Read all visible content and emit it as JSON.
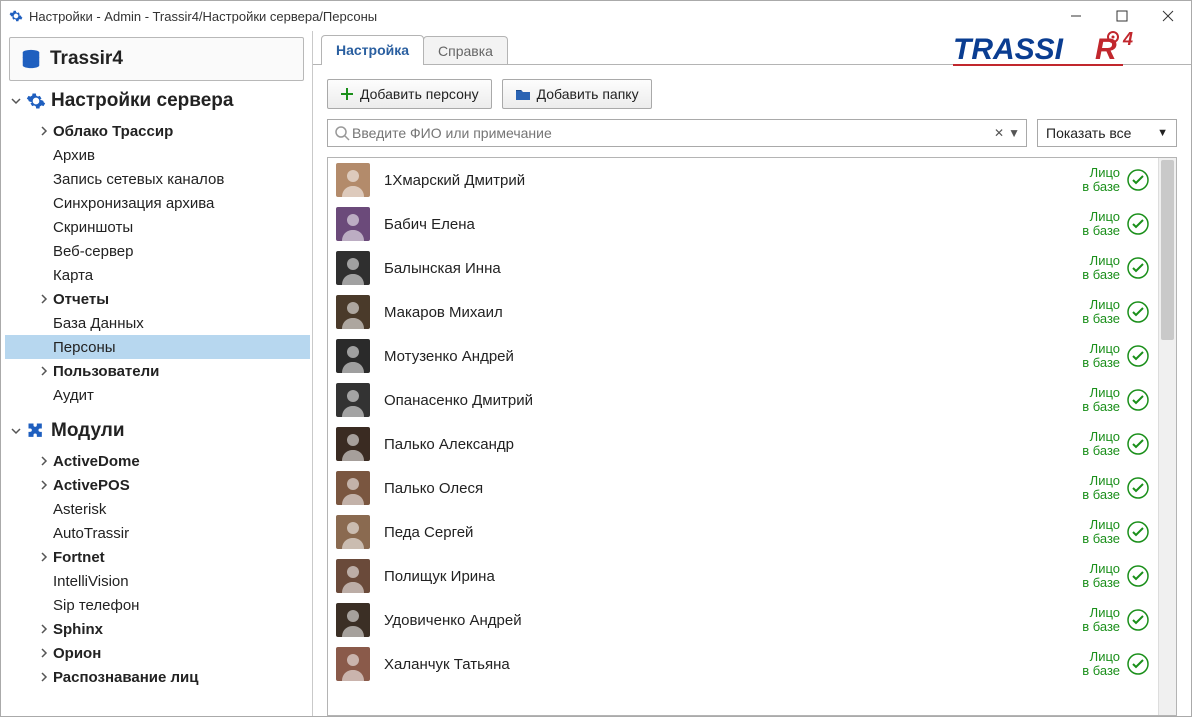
{
  "window": {
    "title": "Настройки - Admin - Trassir4/Настройки сервера/Персоны"
  },
  "logo": {
    "text": "TRASSIR",
    "sup": "4"
  },
  "server": {
    "name": "Trassir4"
  },
  "tree": {
    "serverSettings": "Настройки сервера",
    "items1": [
      {
        "label": "Облако Трассир",
        "bold": true,
        "chev": true
      },
      {
        "label": "Архив"
      },
      {
        "label": "Запись сетевых каналов"
      },
      {
        "label": "Синхронизация архива"
      },
      {
        "label": "Скриншоты"
      },
      {
        "label": "Веб-сервер"
      },
      {
        "label": "Карта"
      },
      {
        "label": "Отчеты",
        "bold": true,
        "chev": true
      },
      {
        "label": "База Данных"
      },
      {
        "label": "Персоны",
        "selected": true
      },
      {
        "label": "Пользователи",
        "bold": true,
        "chev": true
      },
      {
        "label": "Аудит"
      }
    ],
    "modules": "Модули",
    "items2": [
      {
        "label": "ActiveDome",
        "bold": true,
        "chev": true
      },
      {
        "label": "ActivePOS",
        "bold": true,
        "chev": true
      },
      {
        "label": "Asterisk"
      },
      {
        "label": "AutoTrassir"
      },
      {
        "label": "Fortnet",
        "bold": true,
        "chev": true
      },
      {
        "label": "IntelliVision"
      },
      {
        "label": "Sip телефон"
      },
      {
        "label": "Sphinx",
        "bold": true,
        "chev": true
      },
      {
        "label": "Орион",
        "bold": true,
        "chev": true
      },
      {
        "label": "Распознавание лиц",
        "bold": true,
        "chev": true
      }
    ]
  },
  "tabs": {
    "active": "Настройка",
    "other": "Справка"
  },
  "toolbar": {
    "addPerson": "Добавить персону",
    "addFolder": "Добавить папку"
  },
  "search": {
    "placeholder": "Введите ФИО или примечание"
  },
  "filter": {
    "label": "Показать все"
  },
  "badge": {
    "line1": "Лицо",
    "line2": "в базе"
  },
  "persons": [
    {
      "name": "1Хмарский Дмитрий",
      "av": "#b38b6b"
    },
    {
      "name": "Бабич Елена",
      "av": "#6b4a7a"
    },
    {
      "name": "Балынская Инна",
      "av": "#2f2f2f"
    },
    {
      "name": "Макаров Михаил",
      "av": "#4a3a2a"
    },
    {
      "name": "Мотузенко Андрей",
      "av": "#2a2a2a"
    },
    {
      "name": "Опанасенко Дмитрий",
      "av": "#333"
    },
    {
      "name": "Палько Александр",
      "av": "#3a2b22"
    },
    {
      "name": "Палько Олеся",
      "av": "#7a5640"
    },
    {
      "name": "Педа Сергей",
      "av": "#8a6a50"
    },
    {
      "name": "Полищук Ирина",
      "av": "#6a4a3a"
    },
    {
      "name": "Удовиченко Андрей",
      "av": "#3b2f25"
    },
    {
      "name": "Халанчук Татьяна",
      "av": "#8a5a4a"
    }
  ]
}
